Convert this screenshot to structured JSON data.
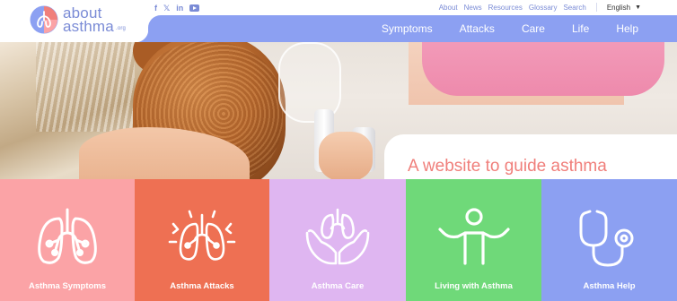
{
  "brand": {
    "line1": "about",
    "line2": "asthma",
    "suffix": ".org"
  },
  "social": {
    "facebook": "f",
    "x": "𝕏",
    "linkedin": "in",
    "youtube_icon": "youtube-icon"
  },
  "utility_links": [
    "About",
    "News",
    "Resources",
    "Glossary",
    "Search"
  ],
  "language": {
    "selected": "English",
    "caret": "▼"
  },
  "main_nav": [
    "Symptoms",
    "Attacks",
    "Care",
    "Life",
    "Help"
  ],
  "hero": {
    "headline": "A website to guide asthma patients and carers ↓"
  },
  "tiles": [
    {
      "label": "Asthma Symptoms",
      "color": "#fba3a6",
      "icon": "lungs-icon"
    },
    {
      "label": "Asthma Attacks",
      "color": "#ee7053",
      "icon": "lungs-alert-icon"
    },
    {
      "label": "Asthma Care",
      "color": "#dfb6f1",
      "icon": "hands-holding-lungs-icon"
    },
    {
      "label": "Living with Asthma",
      "color": "#6fd979",
      "icon": "person-arms-raised-icon"
    },
    {
      "label": "Asthma Help",
      "color": "#8ca0f2",
      "icon": "stethoscope-icon"
    }
  ],
  "colors": {
    "accent": "#8ca0f2",
    "headline": "#f07f7b"
  }
}
